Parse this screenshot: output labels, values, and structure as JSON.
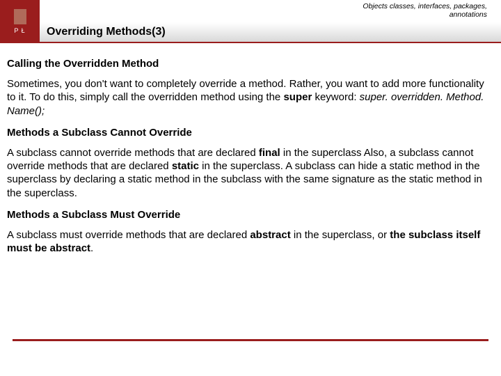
{
  "header": {
    "breadcrumb_line1": "Objects classes, interfaces, packages,",
    "breadcrumb_line2": "annotations",
    "slide_title": "Overriding Methods(3)",
    "logo_letters": "P  Ł"
  },
  "sections": {
    "h1": "Calling the Overridden Method",
    "p1a": "Sometimes, you don't want to completely override a method. Rather, you want to add more functionality to it. To do this, simply call the overridden method using the ",
    "p1_super": "super",
    "p1b": " keyword: ",
    "p1_code": "super. overridden. Method. Name();",
    "h2": "Methods a Subclass Cannot Override",
    "p2a": "A subclass cannot override methods that are declared ",
    "p2_final": "final",
    "p2b": " in the superclass Also, a subclass cannot override methods that are declared ",
    "p2_static": "static",
    "p2c": " in the superclass. A subclass can hide a static method in the superclass by declaring a static method in the subclass with the same signature as the static method in the superclass.",
    "h3": "Methods a Subclass Must Override",
    "p3a": "A subclass must override methods that are declared ",
    "p3_abstract": "abstract",
    "p3b": " in the superclass, or ",
    "p3_bold_end": "the subclass itself must be abstract",
    "p3c": "."
  }
}
